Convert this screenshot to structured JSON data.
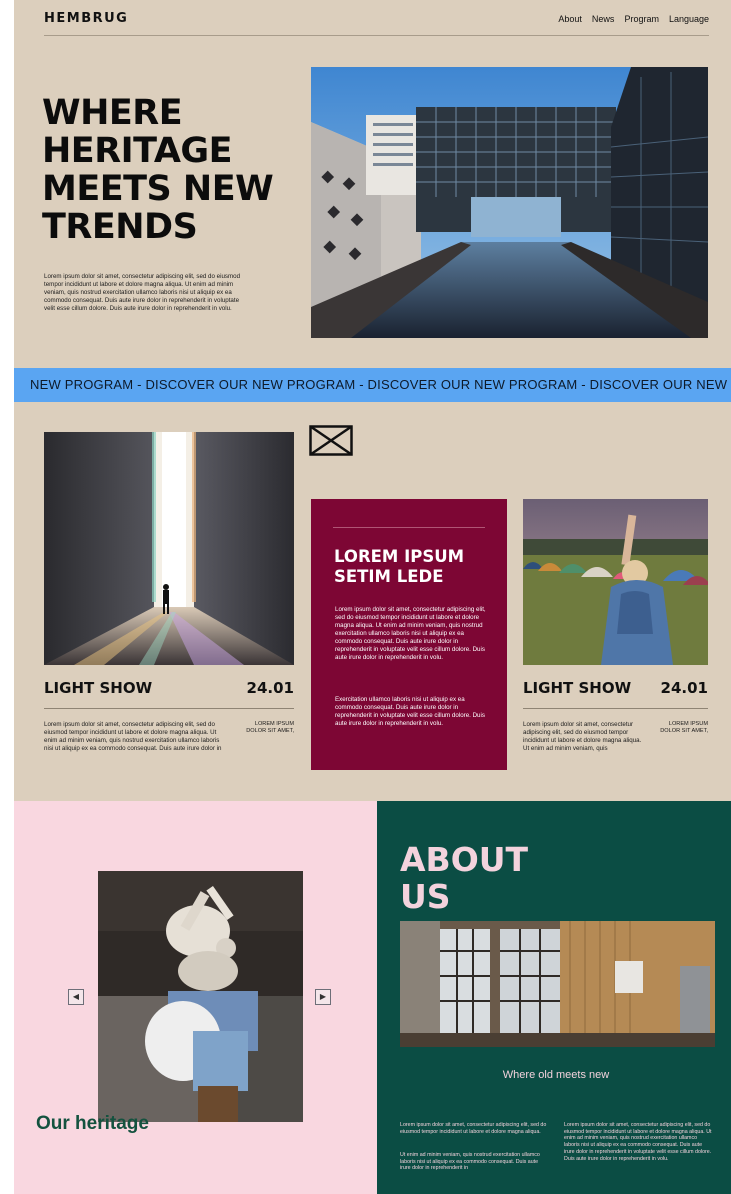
{
  "brand": {
    "logo": "HEMBRUG"
  },
  "nav": {
    "items": [
      "About",
      "News",
      "Program",
      "Language"
    ]
  },
  "hero": {
    "title": "WHERE HERITAGE MEETS NEW TRENDS",
    "text": "Lorem ipsum dolor sit amet, consectetur adipiscing elit, sed do eiusmod tempor incididunt ut labore et dolore magna aliqua. Ut enim ad minim veniam, quis nostrud exercitation ullamco laboris nisi ut aliquip ex ea commodo consequat. Duis aute irure dolor in reprehenderit in voluptate velit esse cillum dolore. Duis aute irure dolor in reprehenderit in volu."
  },
  "ticker": {
    "text": "NEW PROGRAM - DISCOVER OUR NEW PROGRAM - DISCOVER OUR NEW PROGRAM - DISCOVER OUR NEW P"
  },
  "events": [
    {
      "title": "LIGHT SHOW",
      "date": "24.01",
      "text": "Lorem ipsum dolor sit amet, consectetur adipiscing elit, sed do eiusmod tempor incididunt ut labore et dolore magna aliqua. Ut enim ad minim veniam, quis nostrud exercitation ullamco laboris nisi ut aliquip ex ea commodo consequat. Duis aute irure dolor in",
      "side": "LOREM IPSUM DOLOR SIT AMET,"
    },
    {
      "title": "LIGHT SHOW",
      "date": "24.01",
      "text": "Lorem ipsum dolor sit amet, consectetur adipiscing elit, sed do eiusmod tempor incididunt ut labore et dolore magna aliqua. Ut enim ad minim veniam, quis",
      "side": "LOREM IPSUM DOLOR SIT AMET,"
    }
  ],
  "promo": {
    "title": "LOREM IPSUM SETIM LEDE",
    "p1": "Lorem ipsum dolor sit amet, consectetur adipiscing elit, sed do eiusmod tempor incididunt ut labore et dolore magna aliqua. Ut enim ad minim veniam, quis nostrud exercitation ullamco laboris nisi ut aliquip ex ea commodo consequat. Duis aute irure dolor in reprehenderit in voluptate velit esse cillum dolore. Duis aute irure dolor in reprehenderit in volu.",
    "p2": "Exercitation ullamco laboris nisi ut aliquip ex ea commodo consequat. Duis aute irure dolor in reprehenderit in voluptate velit esse cillum dolore. Duis aute irure dolor in reprehenderit in volu."
  },
  "heritage": {
    "title": "Our heritage"
  },
  "about": {
    "title": "ABOUT US",
    "subtitle": "Where old meets new",
    "col1a": "Lorem ipsum dolor sit amet, consectetur adipiscing elit, sed do eiusmod tempor incididunt ut labore et dolore magna aliqua.",
    "col1b": "Ut enim ad minim veniam, quis nostrud exercitation ullamco laboris nisi ut aliquip ex ea commodo consequat. Duis aute irure dolor in reprehenderit in",
    "col2": "Lorem ipsum dolor sit amet, consectetur adipiscing elit, sed do eiusmod tempor incididunt ut labore et dolore magna aliqua. Ut enim ad minim veniam, quis nostrud exercitation ullamco laboris nisi ut aliquip ex ea commodo consequat. Duis aute irure dolor in reprehenderit in voluptate velit esse cillum dolore. Duis aute irure dolor in reprehenderit in volu."
  },
  "colors": {
    "background": "#dccfbd",
    "ticker": "#5aa5f2",
    "promo": "#7d0634",
    "heritage": "#f9d7e0",
    "about": "#0b4d44",
    "about_text": "#f3d3dd",
    "heritage_text": "#14523f"
  },
  "icons": {
    "envelope": "envelope-icon",
    "prev": "arrow-left-icon",
    "next": "arrow-right-icon"
  }
}
